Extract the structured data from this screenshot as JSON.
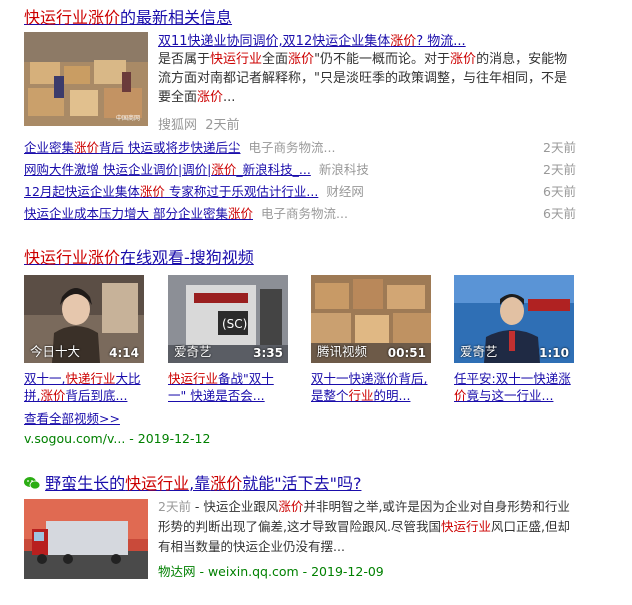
{
  "block1": {
    "title": [
      "快运行业涨价",
      "的最新相关信息"
    ],
    "news": {
      "title": [
        "双11快递业协同调价,双12快运企业集体",
        "涨价",
        "? 物流..."
      ],
      "body": [
        "是否属于",
        "快运行业",
        "全面",
        "涨价",
        "\"仍不能一概而论。对于",
        "涨价",
        "的消息，安能物流方面对南都记者解释称，\"只是淡旺季的政策调整，与往年相同，不是要全面",
        "涨价",
        "..."
      ],
      "source": "搜狐网",
      "time": "2天前"
    },
    "related": [
      {
        "title": [
          "企业密集",
          "涨价",
          "背后 快运或将步快递后尘"
        ],
        "source": "电子商务物流...",
        "time": "2天前"
      },
      {
        "title": [
          "网购大件激增 快运企业调价|调价|",
          "涨价",
          "_新浪科技_..."
        ],
        "source": "新浪科技",
        "time": "2天前"
      },
      {
        "title": [
          "12月起快运企业集体",
          "涨价",
          " 专家称过于乐观估计行业..."
        ],
        "source": "财经网",
        "time": "6天前"
      },
      {
        "title": [
          "快运企业成本压力增大 部分企业密集",
          "涨价"
        ],
        "source": "电子商务物流...",
        "time": "6天前"
      }
    ]
  },
  "block2": {
    "title": [
      "快运行业涨价",
      "在线观看-搜狗视频"
    ],
    "videos": [
      {
        "source": "今日十大",
        "duration": "4:14",
        "caption": [
          "双十一,",
          "快递行业",
          "大比拼,",
          "涨价",
          "背后到底..."
        ]
      },
      {
        "source": "爱奇艺",
        "duration": "3:35",
        "caption": [
          "快运行业",
          "备战\"双十一\" 快递是否会..."
        ]
      },
      {
        "source": "腾讯视频",
        "duration": "00:51",
        "caption": [
          "双十一快递涨价背后,是整个",
          "行业",
          "的明..."
        ]
      },
      {
        "source": "爱奇艺",
        "duration": "1:10",
        "caption": [
          "任平安:双十一快递涨",
          "价",
          "竟与这一行业..."
        ]
      }
    ],
    "more": "查看全部视频>>",
    "url": "v.sogou.com/v... - 2019-12-12"
  },
  "block3": {
    "title": [
      "野蛮生长的",
      "快运行业",
      ",靠",
      "涨价",
      "就能\"活下去\"吗?"
    ],
    "time": "2天前",
    "body": [
      " - 快运企业跟风",
      "涨价",
      "并非明智之举,或许是因为企业对自身形势和行业形势的判断出现了偏差,这才导致冒险跟风.尽管我国",
      "快运行业",
      "风口正盛,但却有相当数量的快运企业仍没有摆..."
    ],
    "meta": "物达网 - weixin.qq.com - 2019-12-09"
  },
  "colors": {
    "link": "#1a0dab",
    "highlight": "#cc0000",
    "green": "#008000",
    "meta": "#999999"
  },
  "icons": [
    "wechat-icon"
  ]
}
